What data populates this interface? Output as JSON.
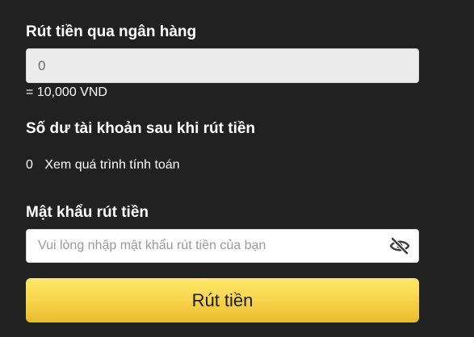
{
  "withdraw": {
    "title": "Rút tiền qua ngân hàng",
    "amount_value": "0",
    "conversion_text": "= 10,000 VND"
  },
  "balance": {
    "title": "Số dư tài khoản sau khi rút tiền",
    "value": "0",
    "calc_link": "Xem quá trình tính toán"
  },
  "password": {
    "title": "Mật khẩu rút tiền",
    "placeholder": "Vui lòng nhập mật khẩu rút tiền của bạn",
    "toggle_icon": "eye-slash-icon"
  },
  "submit": {
    "label": "Rút tiền"
  },
  "colors": {
    "background": "#212121",
    "button_top": "#fde96a",
    "button_bottom": "#e9bb2c"
  }
}
